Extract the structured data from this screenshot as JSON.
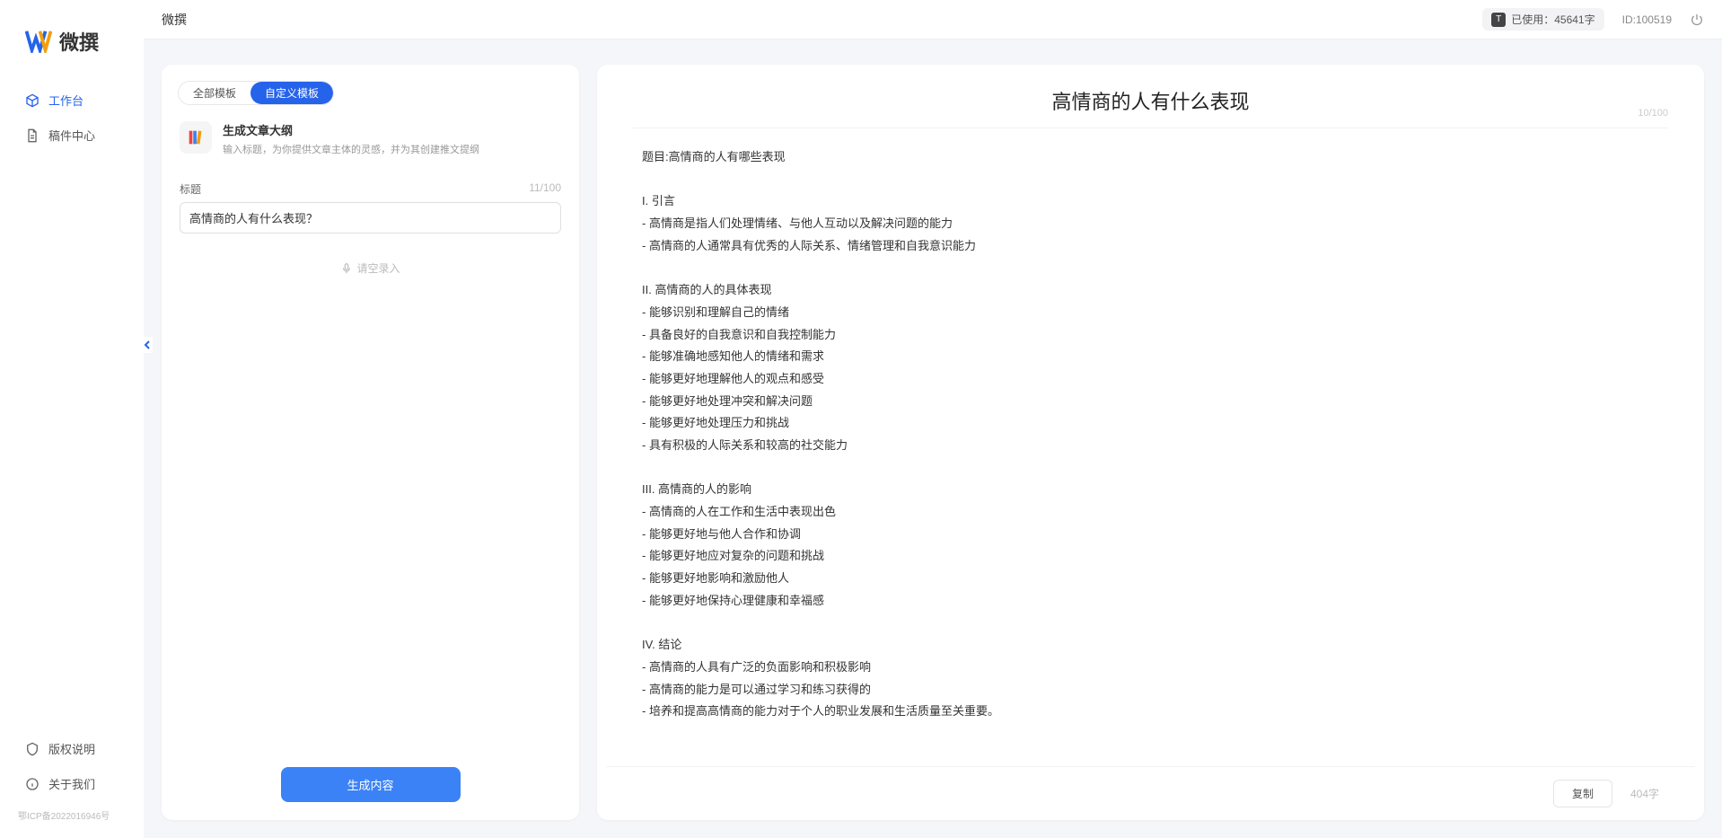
{
  "header": {
    "title": "微撰",
    "usage_label": "已使用：45641字",
    "id_label": "ID:100519"
  },
  "sidebar": {
    "brand": "微撰",
    "nav": [
      {
        "label": "工作台",
        "active": true
      },
      {
        "label": "稿件中心",
        "active": false
      }
    ],
    "bottom": [
      {
        "label": "版权说明"
      },
      {
        "label": "关于我们"
      }
    ],
    "icp": "鄂ICP备2022016946号"
  },
  "left": {
    "tabs": {
      "all": "全部模板",
      "custom": "自定义模板"
    },
    "template": {
      "title": "生成文章大纲",
      "desc": "输入标题，为你提供文章主体的灵感，并为其创建推文提纲"
    },
    "form": {
      "label": "标题",
      "counter": "11/100",
      "value": "高情商的人有什么表现？"
    },
    "voice": "请空录入",
    "generate": "生成内容"
  },
  "output": {
    "title": "高情商的人有什么表现",
    "title_counter": "10/100",
    "body": "题目:高情商的人有哪些表现\n\nI. 引言\n- 高情商是指人们处理情绪、与他人互动以及解决问题的能力\n- 高情商的人通常具有优秀的人际关系、情绪管理和自我意识能力\n\nII. 高情商的人的具体表现\n- 能够识别和理解自己的情绪\n- 具备良好的自我意识和自我控制能力\n- 能够准确地感知他人的情绪和需求\n- 能够更好地理解他人的观点和感受\n- 能够更好地处理冲突和解决问题\n- 能够更好地处理压力和挑战\n- 具有积极的人际关系和较高的社交能力\n\nIII. 高情商的人的影响\n- 高情商的人在工作和生活中表现出色\n- 能够更好地与他人合作和协调\n- 能够更好地应对复杂的问题和挑战\n- 能够更好地影响和激励他人\n- 能够更好地保持心理健康和幸福感\n\nIV. 结论\n- 高情商的人具有广泛的负面影响和积极影响\n- 高情商的能力是可以通过学习和练习获得的\n- 培养和提高高情商的能力对于个人的职业发展和生活质量至关重要。",
    "copy": "复制",
    "word_count": "404字"
  }
}
